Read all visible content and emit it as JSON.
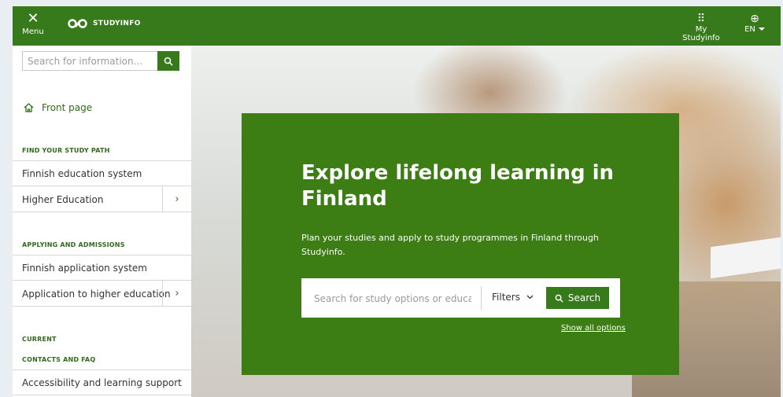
{
  "topbar": {
    "menu_label": "Menu",
    "logo_text": "STUDYINFO",
    "my_studyinfo": "My Studyinfo",
    "lang": "EN"
  },
  "sidebar": {
    "search_placeholder": "Search for information...",
    "front_page": "Front page",
    "sections": [
      {
        "title": "FIND YOUR STUDY PATH",
        "items": [
          {
            "label": "Finnish education system"
          },
          {
            "label": "Higher Education"
          }
        ]
      },
      {
        "title": "APPLYING AND ADMISSIONS",
        "items": [
          {
            "label": "Finnish application system"
          },
          {
            "label": "Application to higher education"
          }
        ]
      },
      {
        "title": "CURRENT"
      },
      {
        "title": "CONTACTS AND FAQ",
        "items": [
          {
            "label": "Accessibility and learning support"
          }
        ]
      }
    ]
  },
  "hero": {
    "title": "Explore lifelong learning in Finland",
    "subtitle": "Plan your studies and apply to study programmes in Finland through Studyinfo.",
    "search_placeholder": "Search for study options or education",
    "filters_label": "Filters",
    "search_button": "Search",
    "show_all": "Show all options"
  },
  "colors": {
    "brand_green": "#367a1b",
    "card_green": "#3c7d14"
  },
  "icons": [
    "close-icon",
    "studyinfo-logo-icon",
    "grid-icon",
    "globe-icon",
    "search-icon",
    "home-icon",
    "chevron-right-icon",
    "chevron-down-icon"
  ]
}
